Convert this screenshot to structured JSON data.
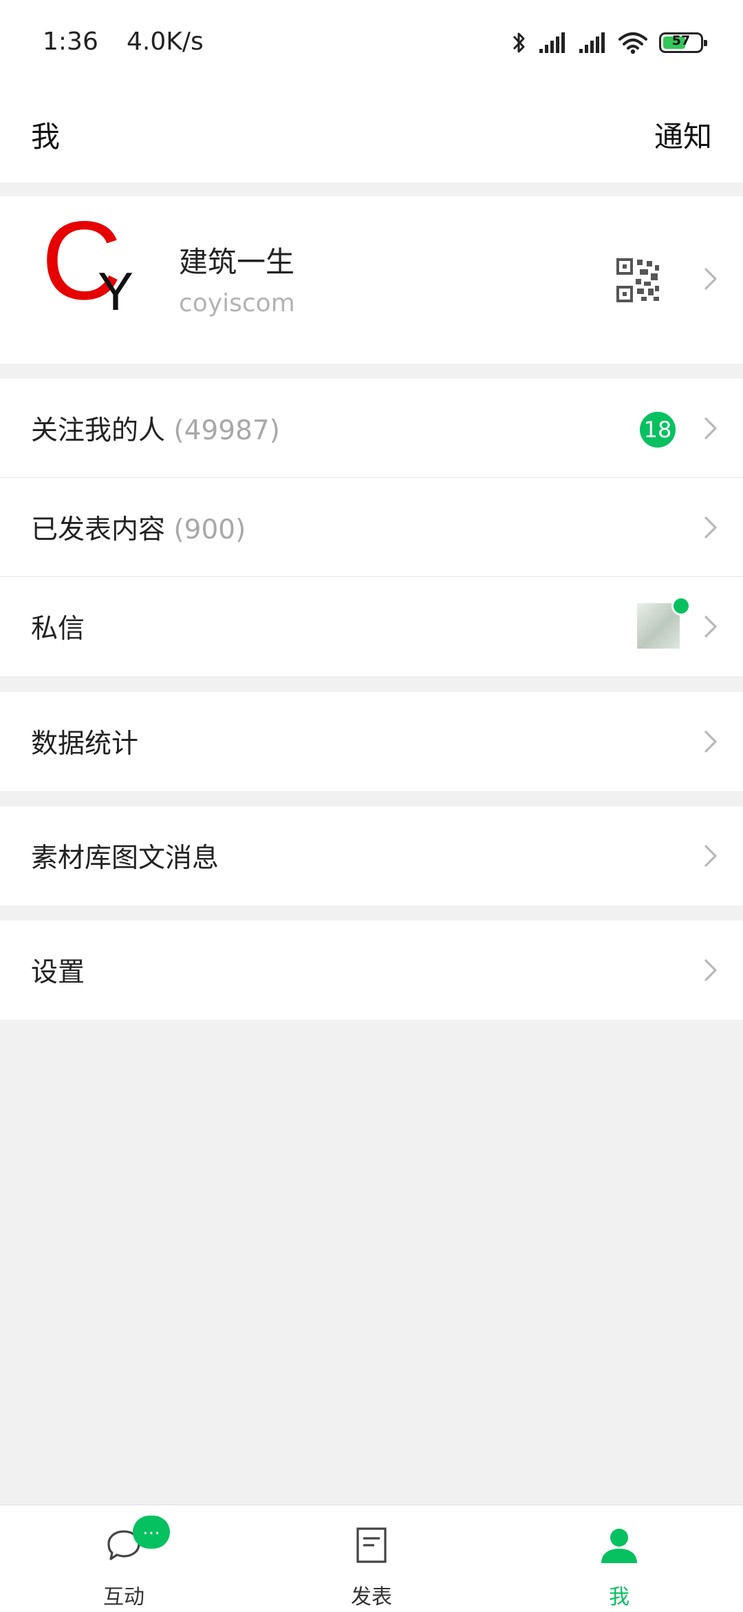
{
  "status_bar": {
    "time": "1:36",
    "net_speed": "4.0K/s",
    "battery_level": "57",
    "icons": [
      "bluetooth-icon",
      "signal-icon",
      "signal-icon",
      "wifi-icon",
      "battery-icon"
    ]
  },
  "header": {
    "title": "我",
    "notice_label": "通知"
  },
  "profile": {
    "avatar_letter_main": "C",
    "avatar_letter_sub": "Y",
    "name": "建筑一生",
    "account_id": "coyiscom"
  },
  "menu": {
    "followers_label": "关注我的人",
    "followers_count": "(49987)",
    "followers_badge": "18",
    "published_label": "已发表内容",
    "published_count": "(900)",
    "messages_label": "私信",
    "stats_label": "数据统计",
    "library_label": "素材库图文消息",
    "settings_label": "设置"
  },
  "tabbar": {
    "tabs": [
      {
        "label": "互动",
        "icon": "chat-bubble-icon",
        "badge": "…"
      },
      {
        "label": "发表",
        "icon": "document-icon"
      },
      {
        "label": "我",
        "icon": "person-icon",
        "active": true
      }
    ]
  },
  "colors": {
    "accent": "#07c160",
    "avatar_red": "#e60000",
    "background": "#f1f1f1"
  }
}
